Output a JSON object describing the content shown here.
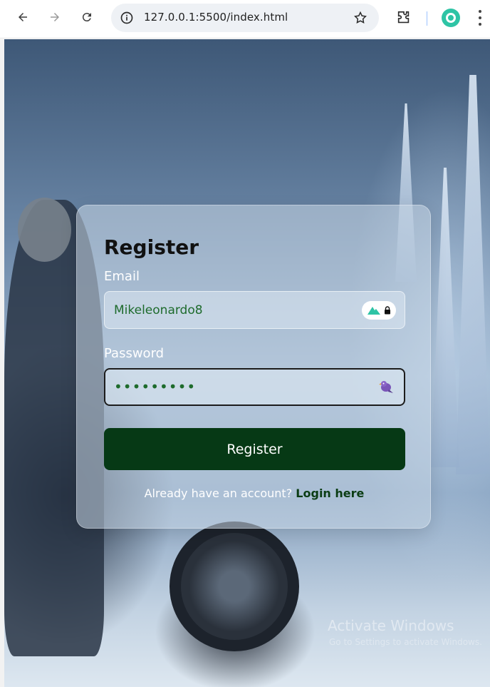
{
  "browser": {
    "url": "127.0.0.1:5500/index.html"
  },
  "form": {
    "title": "Register",
    "email_label": "Email",
    "email_value": "Mikeleonardo8",
    "password_label": "Password",
    "password_masked": "•••••••••",
    "submit_label": "Register",
    "footer_text": "Already have an account?",
    "login_link": "Login here"
  },
  "watermark": {
    "title": "Activate Windows",
    "subtitle": "Go to Settings to activate Windows."
  },
  "colors": {
    "button": "#063915",
    "link": "#0b3d14",
    "input_text": "#1e6b2c",
    "profile": "#2ec4a5"
  }
}
